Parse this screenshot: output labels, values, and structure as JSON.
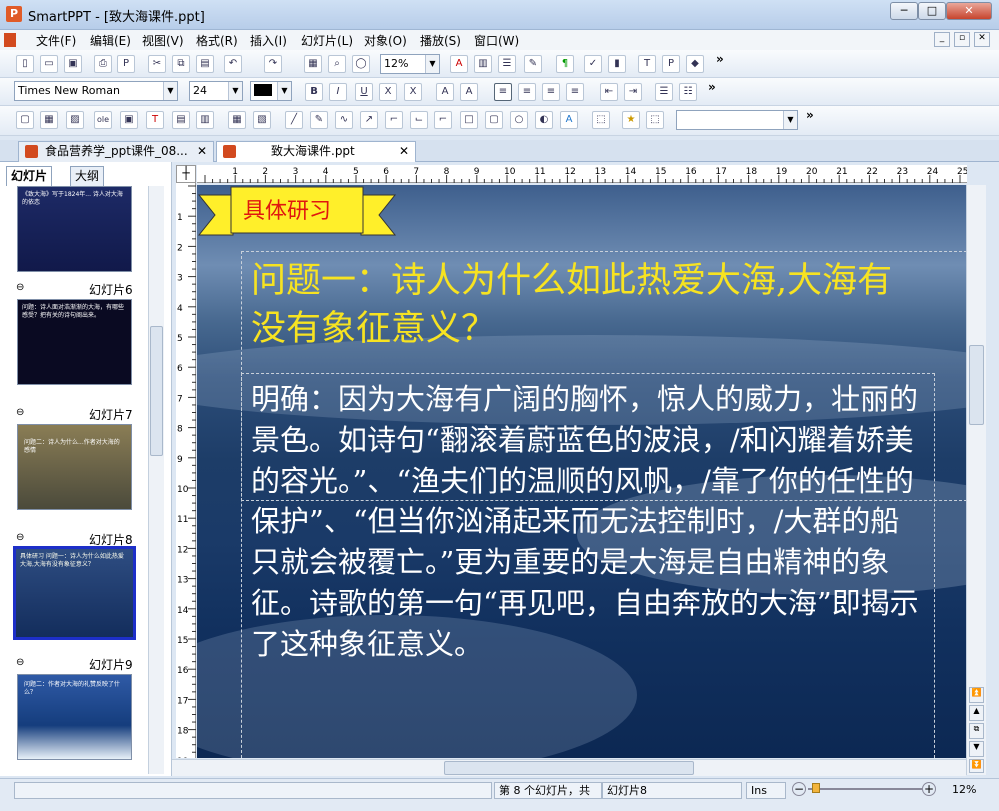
{
  "window": {
    "title": "SmartPPT - [致大海课件.ppt]",
    "app_icon": "P",
    "minimize_glyph": "─",
    "maximize_glyph": "□",
    "close_glyph": "✕"
  },
  "menu": [
    "文件(F)",
    "编辑(E)",
    "视图(V)",
    "格式(R)",
    "插入(I)",
    "幻灯片(L)",
    "对象(O)",
    "播放(S)",
    "窗口(W)"
  ],
  "toolbar": {
    "zoom": "12%",
    "font_name": "Times New Roman",
    "font_size": "24",
    "more": "»"
  },
  "doc_tabs": [
    {
      "label": "食品营养学_ppt课件_08..."
    },
    {
      "label": "致大海课件.ppt"
    }
  ],
  "panel_tabs": [
    "幻灯片",
    "大纲"
  ],
  "thumbnails": [
    {
      "label": "",
      "text": "《致大海》写于1824年... 诗人对大海的依恋"
    },
    {
      "label": "幻灯片6",
      "text": "问题：诗人面对浩渐渐的大海，有哪些感受？把有关的诗句阐出来。"
    },
    {
      "label": "幻灯片7",
      "text": "问题二：诗人为什么...作者对大海的感情"
    },
    {
      "label": "幻灯片8",
      "text": "具体研习 问题一：诗人为什么如此热爱大海,大海有没有象征意义？"
    },
    {
      "label": "幻灯片9",
      "text": "问题二：作者对大海的礼赞反映了什么？"
    }
  ],
  "slide": {
    "banner": "具体研习",
    "title": "问题一：诗人为什么如此热爱大海,大海有没有象征意义？",
    "body": "明确：因为大海有广阔的胸怀，惊人的威力，壮丽的景色。如诗句“翻滚着蔚蓝色的波浪，/和闪耀着娇美的容光。”、“渔夫们的温顺的风帆，/靠了你的任性的保护”、“但当你汹涌起来而无法控制时，/大群的船只就会被覆亡。”更为重要的是大海是自由精神的象征。诗歌的第一句“再见吧，自由奔放的大海”即揭示了这种象征意义。"
  },
  "status": {
    "slide_info": "第 8 个幻灯片，共",
    "slide_name": "幻灯片8",
    "mode": "Ins",
    "zoom": "12%",
    "zoom_minus": "−",
    "zoom_plus": "+"
  },
  "colors": {
    "title_yellow": "#f7e321",
    "banner_yellow": "#ffef2a",
    "banner_text": "#e0170f",
    "selected_border": "#1d2fc9"
  }
}
